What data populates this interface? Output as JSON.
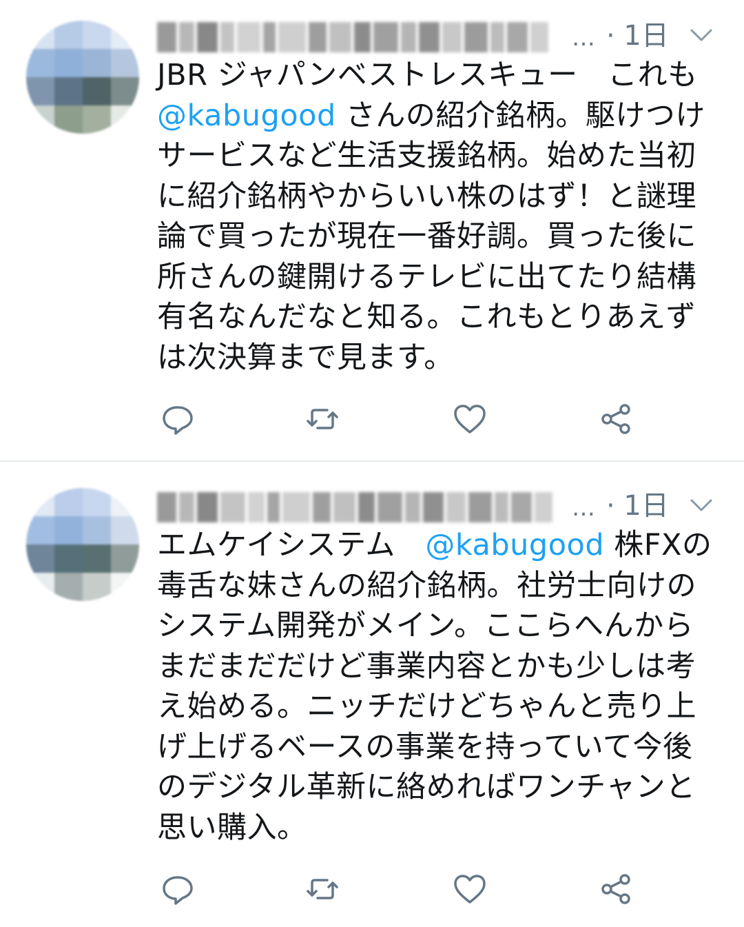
{
  "tweets": [
    {
      "ellipsis": "…",
      "time": "· 1日",
      "segments": [
        {
          "text": "JBR ジャパンベストレスキュー　これも\n",
          "type": "text"
        },
        {
          "text": "@kabugood",
          "type": "mention"
        },
        {
          "text": " さんの紹介銘柄。駆けつけサービスなど生活支援銘柄。始めた当初に紹介銘柄やからいい株のはず！と謎理論で買ったが現在一番好調。買った後に所さんの鍵開けるテレビに出てたり結構有名なんだなと知る。これもとりあえずは次決算まで見ます。",
          "type": "text"
        }
      ],
      "actions": {
        "reply": "reply-icon",
        "retweet": "retweet-icon",
        "like": "heart-icon",
        "share": "share-icon"
      }
    },
    {
      "ellipsis": "…",
      "time": "· 1日",
      "segments": [
        {
          "text": "エムケイシステム　",
          "type": "text"
        },
        {
          "text": "@kabugood",
          "type": "mention"
        },
        {
          "text": " 株FXの毒舌な妹さんの紹介銘柄。社労士向けのシステム開発がメイン。ここらへんからまだまだだけど事業内容とかも少しは考え始める。ニッチだけどちゃんと売り上げ上げるベースの事業を持っていて今後のデジタル革新に絡めればワンチャンと思い購入。",
          "type": "text"
        }
      ],
      "actions": {
        "reply": "reply-icon",
        "retweet": "retweet-icon",
        "like": "heart-icon",
        "share": "share-icon"
      }
    }
  ],
  "colors": {
    "mention": "#1da1f2",
    "muted": "#657786",
    "icon": "#657786",
    "divider": "#e6ecf0"
  }
}
